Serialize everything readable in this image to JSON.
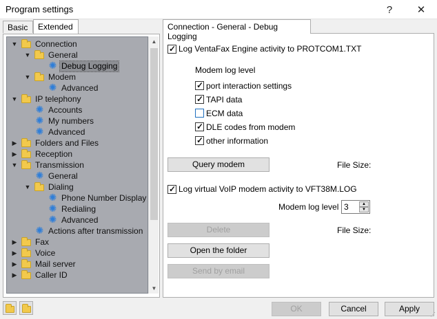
{
  "window": {
    "title": "Program settings",
    "help": "?",
    "close": "✕"
  },
  "tabs_left": {
    "basic": "Basic",
    "extended": "Extended"
  },
  "tree": [
    {
      "label": "Connection",
      "depth": 0,
      "exp": "▼",
      "icon": "folder"
    },
    {
      "label": "General",
      "depth": 1,
      "exp": "▼",
      "icon": "folder"
    },
    {
      "label": "Debug Logging",
      "depth": 2,
      "exp": "",
      "icon": "gear",
      "selected": true
    },
    {
      "label": "Modem",
      "depth": 1,
      "exp": "▼",
      "icon": "folder"
    },
    {
      "label": "Advanced",
      "depth": 2,
      "exp": "",
      "icon": "gear"
    },
    {
      "label": "IP telephony",
      "depth": 0,
      "exp": "▼",
      "icon": "folder"
    },
    {
      "label": "Accounts",
      "depth": 1,
      "exp": "",
      "icon": "gear"
    },
    {
      "label": "My numbers",
      "depth": 1,
      "exp": "",
      "icon": "gear"
    },
    {
      "label": "Advanced",
      "depth": 1,
      "exp": "",
      "icon": "gear"
    },
    {
      "label": "Folders and Files",
      "depth": 0,
      "exp": "▶",
      "icon": "folder"
    },
    {
      "label": "Reception",
      "depth": 0,
      "exp": "▶",
      "icon": "folder"
    },
    {
      "label": "Transmission",
      "depth": 0,
      "exp": "▼",
      "icon": "folder"
    },
    {
      "label": "General",
      "depth": 1,
      "exp": "",
      "icon": "gear"
    },
    {
      "label": "Dialing",
      "depth": 1,
      "exp": "▼",
      "icon": "folder"
    },
    {
      "label": "Phone Number Display",
      "depth": 2,
      "exp": "",
      "icon": "gear"
    },
    {
      "label": "Redialing",
      "depth": 2,
      "exp": "",
      "icon": "gear"
    },
    {
      "label": "Advanced",
      "depth": 2,
      "exp": "",
      "icon": "gear"
    },
    {
      "label": "Actions after transmission",
      "depth": 1,
      "exp": "",
      "icon": "gear"
    },
    {
      "label": "Fax",
      "depth": 0,
      "exp": "▶",
      "icon": "folder"
    },
    {
      "label": "Voice",
      "depth": 0,
      "exp": "▶",
      "icon": "folder"
    },
    {
      "label": "Mail server",
      "depth": 0,
      "exp": "▶",
      "icon": "folder"
    },
    {
      "label": "Caller ID",
      "depth": 0,
      "exp": "▶",
      "icon": "folder"
    }
  ],
  "panel": {
    "tab_title": "Connection - General - Debug Logging",
    "log_engine": {
      "label": "Log VentaFax Engine activity to PROTCOM1.TXT",
      "checked": true
    },
    "modem_log_level": "Modem log level",
    "options": [
      {
        "label": "port interaction settings",
        "checked": true
      },
      {
        "label": "TAPI data",
        "checked": true
      },
      {
        "label": "ECM data",
        "checked": false
      },
      {
        "label": "DLE codes from modem",
        "checked": true
      },
      {
        "label": "other information",
        "checked": true
      }
    ],
    "query_modem": "Query modem",
    "file_size_1": "File Size:",
    "log_voip": {
      "label": "Log virtual VoIP modem activity to VFT38M.LOG",
      "checked": true
    },
    "voip_level_label": "Modem log level",
    "voip_level_value": "3",
    "delete": "Delete",
    "file_size_2": "File Size:",
    "open_folder": "Open the folder",
    "send_email": "Send by email"
  },
  "buttons": {
    "ok": "OK",
    "cancel": "Cancel",
    "apply": "Apply"
  }
}
